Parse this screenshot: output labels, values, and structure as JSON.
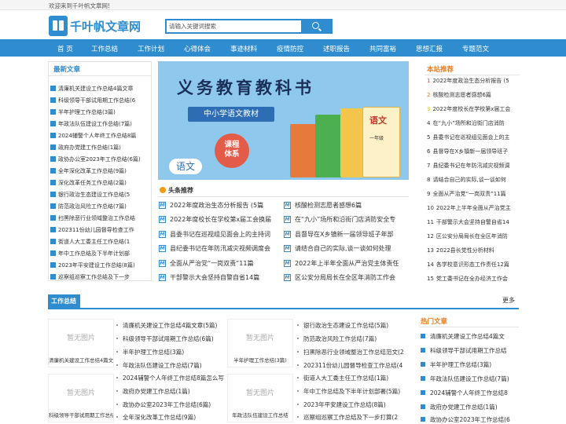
{
  "topbar": {
    "welcome": "欢迎来到千叶帆文章网!"
  },
  "logo": {
    "name": "千叶帆文章网"
  },
  "search": {
    "placeholder": "请输入关键词搜索"
  },
  "nav": [
    "首 页",
    "工作总结",
    "工作计划",
    "心得体会",
    "事迹材料",
    "疫情防控",
    "述职报告",
    "共同富裕",
    "思想汇报",
    "专题范文"
  ],
  "latest": {
    "title": "最新文章",
    "items": [
      "清廉机关建设工作总结4篇文章",
      "科级领导干部试用期工作总结(6",
      "半年护理工作总结(3篇)",
      "年政法队伍建设工作总结(7篇)",
      "2024辅警个人年终工作总结8篇",
      "政府办党建工作总结(1篇)",
      "政协办公室2023年工作总结(6篇)",
      "全年深化改革工作总结(9篇)",
      "深化改革任务工作总结(2篇)",
      "银行政治生态建设工作总结(5",
      "防范政治风险工作总结(7篇)",
      "扫黑除恶行业领域整治工作总结",
      "202311份幼儿园督导检查工作",
      "街道人大工委主任工作总结(1",
      "年中工作总结及下半年计划部",
      "2023年平安建设工作总结(8篇)",
      "巡察组巡察工作总结及下一步"
    ]
  },
  "banner": {
    "title": "义务教育教科书",
    "subtitle": "中小学语文教材",
    "badge_line1": "课程",
    "badge_line2": "体系",
    "yuwen": "语文",
    "book_label": "语文",
    "book_grade": "一年级"
  },
  "headlines": {
    "title": "头条推荐",
    "left": [
      "2022年度政治生态分析报告 (5篇",
      "2022年度校长在学校第x届工会换届",
      "县委书记在巡视组见面会上的主持词",
      "县纪委书记在年防汛减灾视频调度会",
      "全面从严治党“一岗双责”11篇",
      "干部警示大会坚持自警自省14篇"
    ],
    "right": [
      "核酸检测志愿者感想6篇",
      "在“九小”场所和沿街门店消防安全专",
      "县督导在X乡镇新一届领导班子年部",
      "请结合自己的实际,谈一谈如何处理",
      "2022年上半年全面从严治党主体责任",
      "区公安分局局长在全区年消防工作会"
    ]
  },
  "recommend": {
    "title": "本站推荐",
    "items": [
      {
        "n": "1",
        "t": "2022年度政治生态分析报告 (5"
      },
      {
        "n": "2",
        "t": "核酸检测志愿者感想6篇"
      },
      {
        "n": "3",
        "t": "2022年度校长在学校第x届工会"
      },
      {
        "n": "4",
        "t": "在“九小”场所和沿街门店消防"
      },
      {
        "n": "5",
        "t": "县委书记在巡视组见面会上的主"
      },
      {
        "n": "6",
        "t": "县督导在X乡镇新一届领导班子"
      },
      {
        "n": "7",
        "t": "县纪委书记在年防汛减灾视频调"
      },
      {
        "n": "8",
        "t": "请结合自己的实际,谈一谈如何"
      },
      {
        "n": "9",
        "t": "全面从严治党“一岗双责”11篇"
      },
      {
        "n": "10",
        "t": "2022年上半年全面从严治党主"
      },
      {
        "n": "11",
        "t": "干部警示大会坚持自警自省14"
      },
      {
        "n": "12",
        "t": "区公安分局局长在全区年消防"
      },
      {
        "n": "13",
        "t": "2022县长党性分析材料"
      },
      {
        "n": "14",
        "t": "各学校意识形态工作责任12篇"
      },
      {
        "n": "15",
        "t": "党工委书记在全办经济工作会"
      }
    ]
  },
  "section": {
    "title": "工作总结",
    "more": "更多",
    "no_image": "暂无图片",
    "cards": [
      "清廉机关建设工作总结4篇文章",
      "半年护理工作总结(3篇)",
      "科级领导干部试用期工作总结",
      "年政法队伍建设工作总结"
    ],
    "col1": [
      "清廉机关建设工作总结4篇文章(5篇)",
      "科级领导干部试用期工作总结(6篇)",
      "半年护理工作总结(3篇)",
      "年政法队伍建设工作总结(7篇)",
      "2024辅警个人年终工作总结8篇怎么写",
      "政府办党建工作总结(1篇)",
      "政协办公室2023年工作总结(6篇)",
      "全年深化改革工作总结(9篇)"
    ],
    "col2": [
      "银行政治生态建设工作总结(5篇)",
      "防范政治风险工作总结(7篇)",
      "扫黑除恶行业领域整治工作总结范文(2",
      "202311份幼儿园督导检查工作总结(4",
      "街道人大工委主任工作总结(1篇)",
      "年中工作总结及下半年计划部署(5篇)",
      "2023年平安建设工作总结(8篇)",
      "巡察组巡察工作总结及下一步打算(2"
    ]
  },
  "hot": {
    "title": "热门文章",
    "items": [
      "清廉机关建设工作总结4篇文",
      "科级领导干部试用期工作总结",
      "半年护理工作总结(3篇)",
      "年政法队伍建设工作总结(7篇)",
      "2024辅警个人年终工作总结8",
      "政府办党建工作总结(1篇)",
      "政协办公室2023年工作总结(6"
    ]
  }
}
